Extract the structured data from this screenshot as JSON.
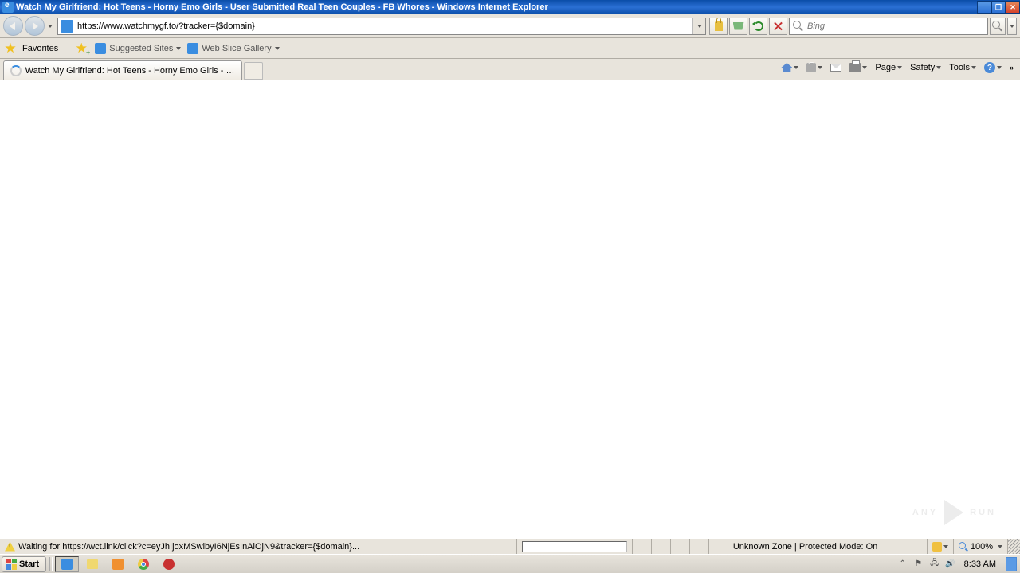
{
  "window": {
    "title": "Watch My Girlfriend: Hot Teens - Horny Emo Girls - User Submitted Real Teen Couples - FB Whores - Windows Internet Explorer"
  },
  "addressbar": {
    "url": "https://www.watchmygf.to/?tracker={$domain}"
  },
  "search": {
    "placeholder": "Bing"
  },
  "favorites": {
    "label": "Favorites",
    "suggested": "Suggested Sites",
    "webslice": "Web Slice Gallery"
  },
  "tab": {
    "title": "Watch My Girlfriend: Hot Teens - Horny Emo Girls - Us..."
  },
  "commandbar": {
    "page": "Page",
    "safety": "Safety",
    "tools": "Tools"
  },
  "statusbar": {
    "message": "Waiting for https://wct.link/click?c=eyJhIjoxMSwibyI6NjEsInAiOjN9&tracker={$domain}...",
    "zone": "Unknown Zone | Protected Mode: On",
    "zoom": "100%"
  },
  "taskbar": {
    "start": "Start",
    "clock": "8:33 AM"
  },
  "watermark": {
    "left": "ANY",
    "right": "RUN"
  }
}
